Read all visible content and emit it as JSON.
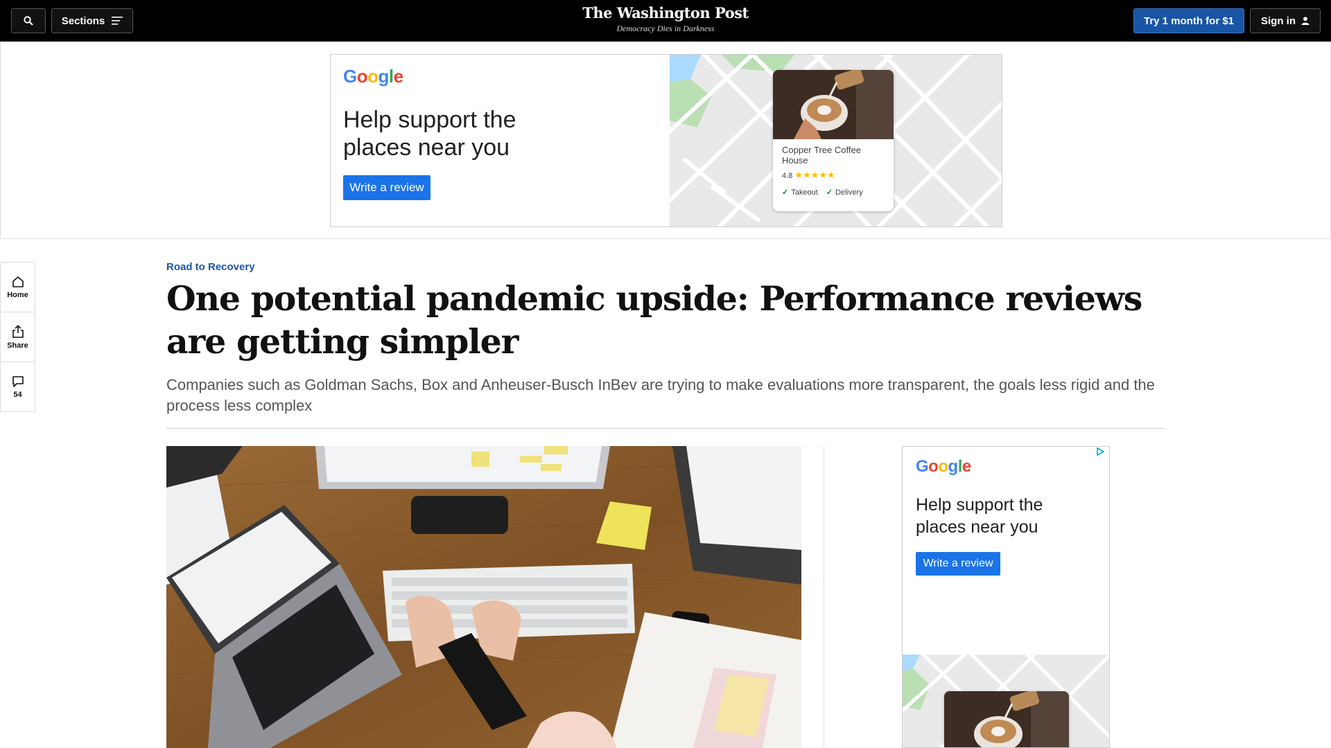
{
  "nav": {
    "sections_label": "Sections",
    "brand": "The Washington Post",
    "tagline": "Democracy Dies in Darkness",
    "subscribe_label": "Try 1 month for $1",
    "signin_label": "Sign in"
  },
  "top_ad": {
    "brand": [
      "G",
      "o",
      "o",
      "g",
      "l",
      "e"
    ],
    "headline": "Help support the places near you",
    "cta": "Write a review",
    "place_name": "Copper Tree Coffee House",
    "rating": "4.8",
    "stars": "★★★★★",
    "option_1": "Takeout",
    "option_2": "Delivery"
  },
  "rail": {
    "home_label": "Home",
    "share_label": "Share",
    "comments_count": "54"
  },
  "article": {
    "kicker": "Road to Recovery",
    "headline": "One potential pandemic upside: Performance reviews are getting simpler",
    "dek": "Companies such as Goldman Sachs, Box and Anheuser-Busch InBev are trying to make evaluations more transparent, the goals less rigid and the process less complex"
  },
  "side_ad": {
    "brand": [
      "G",
      "o",
      "o",
      "g",
      "l",
      "e"
    ],
    "headline": "Help support the places near you",
    "cta": "Write a review"
  },
  "colors": {
    "nav_bg": "#000000",
    "accent_blue": "#1955a5",
    "ad_button": "#1a73e8",
    "kicker": "#1955a5"
  }
}
